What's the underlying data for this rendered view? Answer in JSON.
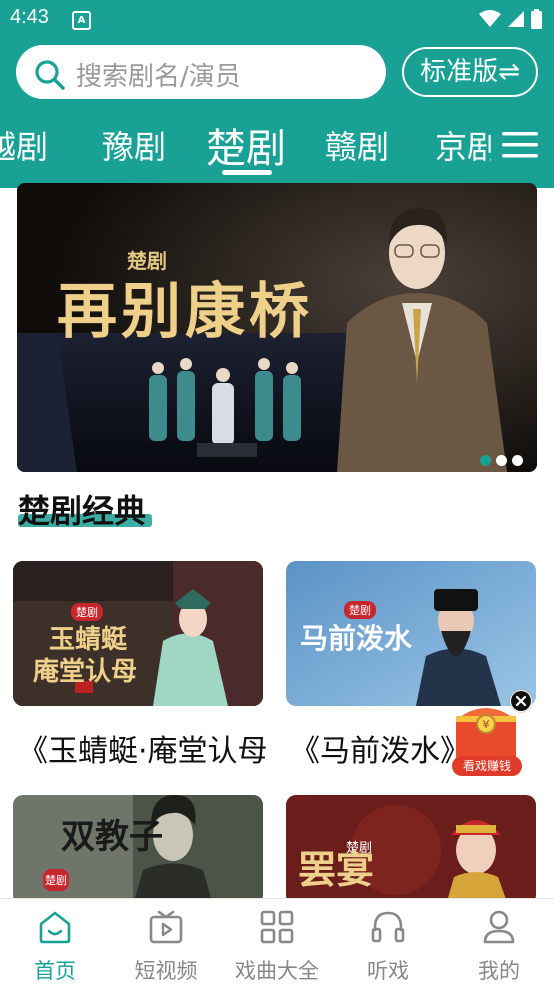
{
  "status": {
    "time": "4:43",
    "notif_letter": "A"
  },
  "search": {
    "placeholder": "搜索剧名/演员"
  },
  "version_button": {
    "label": "标准版⇌"
  },
  "tabs": [
    {
      "label": "越剧"
    },
    {
      "label": "豫剧"
    },
    {
      "label": "楚剧"
    },
    {
      "label": "赣剧"
    },
    {
      "label": "京剧"
    }
  ],
  "banner": {
    "badge": "楚剧",
    "title": "再别康桥",
    "slide_count": 3,
    "active_slide": 0
  },
  "section": {
    "title": "楚剧经典"
  },
  "cards": [
    {
      "title": "《玉蜻蜓·庵堂认母》",
      "poster_badge": "楚剧",
      "poster_title_line1": "玉蜻蜓",
      "poster_title_line2": "庵堂认母"
    },
    {
      "title": "《马前泼水》",
      "poster_badge": "楚剧",
      "poster_title_line1": "马前泼水"
    },
    {
      "poster_badge": "楚剧",
      "poster_title_line1": "双教子"
    },
    {
      "poster_badge": "楚剧",
      "poster_title_line1": "罢宴"
    }
  ],
  "float_widget": {
    "label": "看戏赚钱"
  },
  "bottom_nav": [
    {
      "label": "首页",
      "icon": "home-icon",
      "active": true
    },
    {
      "label": "短视频",
      "icon": "tv-icon"
    },
    {
      "label": "戏曲大全",
      "icon": "grid-icon"
    },
    {
      "label": "听戏",
      "icon": "headphones-icon"
    },
    {
      "label": "我的",
      "icon": "user-icon"
    }
  ],
  "colors": {
    "accent": "#1aa195",
    "text": "#111111",
    "muted": "#888888",
    "badge_red": "#c8262d"
  }
}
